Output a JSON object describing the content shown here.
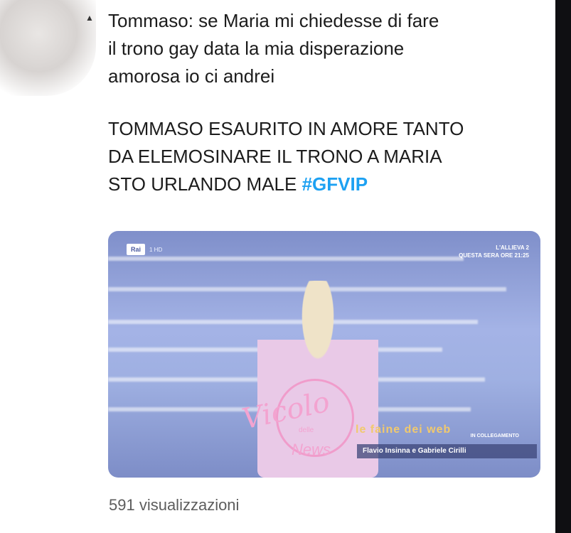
{
  "tweet": {
    "lines": [
      "Tommaso: se Maria mi chiedesse di fare",
      "il trono gay data la mia disperazione",
      "amorosa io ci andrei"
    ],
    "caps_lines": [
      "TOMMASO ESAURITO IN AMORE TANTO",
      "DA ELEMOSINARE IL TRONO A MARIA",
      "STO URLANDO MALE"
    ],
    "hashtag": "#GFVIP"
  },
  "video": {
    "channel_logo": "Rai",
    "channel_sub": "1 HD",
    "promo": {
      "line1": "L'ALLIEVA 2",
      "line2": "QUESTA SERA ORE 21:25"
    },
    "ticker_label": "IN COLLEGAMENTO",
    "ticker": "Flavio Insinna e Gabriele Cirilli"
  },
  "watermark": {
    "main": "Vicolo",
    "small": "delle",
    "news": "News",
    "right": "le faine dei web"
  },
  "views": "591 visualizzazioni",
  "colors": {
    "hashtag": "#1da1f2",
    "watermark": "#f3a3d0"
  }
}
